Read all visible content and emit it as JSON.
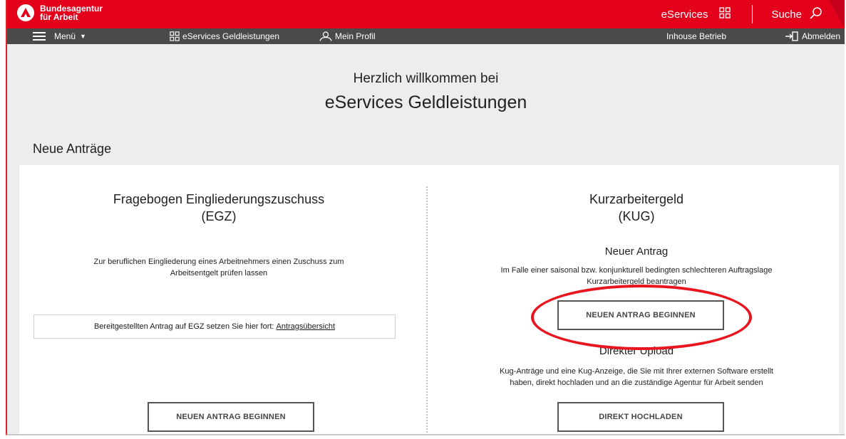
{
  "brand": {
    "line1": "Bundesagentur",
    "line2": "für Arbeit",
    "color": "#e3001b"
  },
  "topbar": {
    "eservices_label": "eServices",
    "search_label": "Suche"
  },
  "nav": {
    "menu_label": "Menü",
    "eservices_label": "eServices Geldleistungen",
    "profile_label": "Mein Profil",
    "inhouse_label": "Inhouse Betrieb",
    "logout_label": "Abmelden"
  },
  "welcome": {
    "line1": "Herzlich willkommen bei",
    "line2": "eServices Geldleistungen"
  },
  "section_title": "Neue Anträge",
  "egz": {
    "title_line1": "Fragebogen Eingliederungszuschuss",
    "title_line2": "(EGZ)",
    "description_line1": "Zur beruflichen Eingliederung eines Arbeitnehmers einen Zuschuss zum",
    "description_line2": "Arbeitsentgelt prüfen lassen",
    "continue_text": "Bereitgestellten Antrag auf EGZ setzen Sie hier fort:",
    "continue_link": "Antragsübersicht",
    "start_button": "NEUEN ANTRAG BEGINNEN"
  },
  "kug": {
    "title_line1": "Kurzarbeitergeld",
    "title_line2": "(KUG)",
    "new_heading": "Neuer Antrag",
    "new_desc_line1": "Im Falle einer saisonal bzw. konjunkturell bedingten schlechteren Auftragslage",
    "new_desc_line2": "Kurzarbeitergeld beantragen",
    "start_button": "NEUEN ANTRAG BEGINNEN",
    "upload_heading": "Direkter Upload",
    "upload_desc_line1": "Kug-Anträge und eine Kug-Anzeige, die Sie mit Ihrer externen Software erstellt",
    "upload_desc_line2": "haben, direkt hochladen und an die zuständige Agentur für Arbeit senden",
    "upload_button": "DIREKT HOCHLADEN"
  },
  "colors": {
    "highlight": "#e8141e",
    "navbar": "#4a4a4a",
    "background": "#ededed"
  }
}
